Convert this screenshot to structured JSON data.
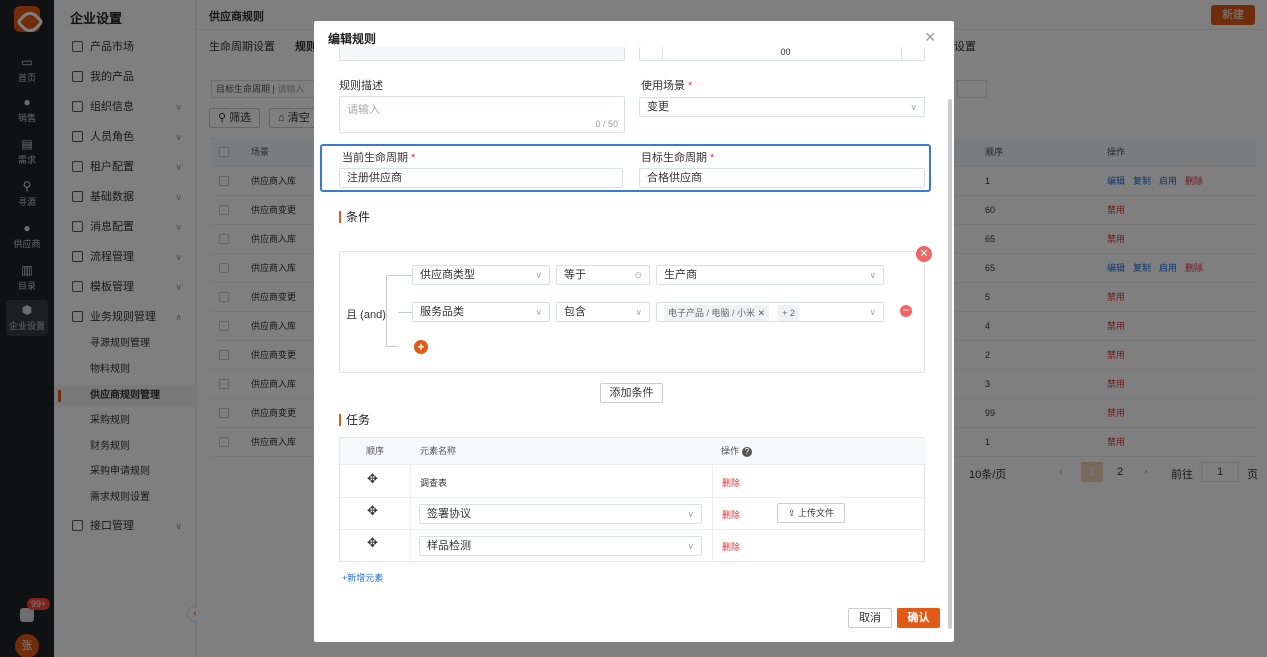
{
  "rail": {
    "items": [
      "首页",
      "销售",
      "需求",
      "寻源",
      "供应商",
      "目录",
      "企业设置"
    ],
    "badge": "99+",
    "avatar": "张"
  },
  "sidebar": {
    "title": "企业设置",
    "items": [
      "产品市场",
      "我的产品",
      "组织信息",
      "人员角色",
      "租户配置",
      "基础数据",
      "消息配置",
      "流程管理",
      "模板管理",
      "业务规则管理"
    ],
    "sub_items": [
      "寻源规则管理",
      "物料规则",
      "供应商规则管理",
      "采购规则",
      "财务规则",
      "采购申请规则",
      "需求规则设置"
    ],
    "last_item": "接口管理"
  },
  "page": {
    "breadcrumb": "供应商规则",
    "new_button": "新建",
    "tabs": [
      "生命周期设置",
      "规则",
      "设置"
    ],
    "filter_label": "目标生命周期",
    "filter_placeholder": "请输入",
    "filter_button": "筛选",
    "clear_button": "清空",
    "table": {
      "headers": [
        "场景",
        "顺序",
        "操作"
      ],
      "rows": [
        {
          "scene": "供应商入库",
          "order": "1",
          "actions": [
            "编辑",
            "复制",
            "启用",
            "删除"
          ]
        },
        {
          "scene": "供应商变更",
          "order": "60",
          "actions": [
            "禁用"
          ]
        },
        {
          "scene": "供应商入库",
          "order": "65",
          "actions": [
            "禁用"
          ]
        },
        {
          "scene": "供应商入库",
          "order": "65",
          "actions": [
            "编辑",
            "复制",
            "启用",
            "删除"
          ]
        },
        {
          "scene": "供应商变更",
          "order": "5",
          "actions": [
            "禁用"
          ]
        },
        {
          "scene": "供应商入库",
          "order": "4",
          "actions": [
            "禁用"
          ]
        },
        {
          "scene": "供应商变更",
          "order": "2",
          "actions": [
            "禁用"
          ]
        },
        {
          "scene": "供应商入库",
          "order": "3",
          "actions": [
            "禁用"
          ]
        },
        {
          "scene": "供应商变更",
          "order": "99",
          "actions": [
            "禁用"
          ]
        },
        {
          "scene": "供应商入库",
          "order": "1",
          "actions": [
            "禁用"
          ]
        }
      ]
    },
    "pager": {
      "page_size": "10条/页",
      "current": "1",
      "next_page": "2",
      "goto_label": "前往",
      "goto_value": "1",
      "page_unit": "页"
    }
  },
  "modal": {
    "title": "编辑规则",
    "description_label": "规则描述",
    "description_placeholder": "请输入",
    "description_count": "0 / 50",
    "scenario_label": "使用场景",
    "scenario_value": "变更",
    "current_lifecycle_label": "当前生命周期",
    "current_lifecycle_value": "注册供应商",
    "target_lifecycle_label": "目标生命周期",
    "target_lifecycle_value": "合格供应商",
    "conditions_title": "条件",
    "logic": "且 (and)",
    "conditions": [
      {
        "field": "供应商类型",
        "operator": "等于",
        "value": "生产商"
      },
      {
        "field": "服务品类",
        "operator": "包含",
        "tags": [
          "电子产品 / 电脑 / 小米",
          "+ 2"
        ]
      }
    ],
    "add_condition": "添加条件",
    "tasks_title": "任务",
    "task_headers": [
      "顺序",
      "元素名称",
      "操作"
    ],
    "tasks": [
      {
        "name": "调查表",
        "action": "删除"
      },
      {
        "name": "签署协议",
        "action": "删除",
        "upload": "上传文件"
      },
      {
        "name": "样品检测",
        "action": "删除"
      }
    ],
    "add_element": "+新增元素",
    "cancel": "取消",
    "confirm": "确认",
    "top_partial": "00"
  }
}
